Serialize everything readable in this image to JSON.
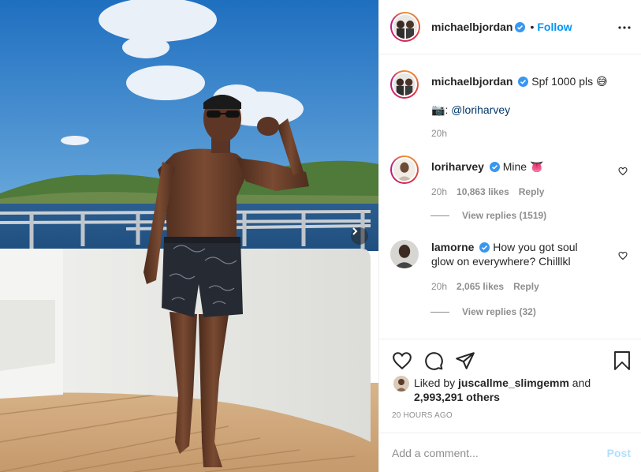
{
  "header": {
    "username": "michaelbjordan",
    "follow_label": "Follow",
    "separator": "•",
    "more_icon": "more-dots-icon"
  },
  "caption": {
    "username": "michaelbjordan",
    "text": "Spf 1000 pls 😅",
    "camera_emoji": "📷",
    "mention": "@loriharvey",
    "time": "20h"
  },
  "comments": [
    {
      "username": "loriharvey",
      "text": "Mine 👅",
      "time": "20h",
      "likes": "10,863 likes",
      "reply_label": "Reply",
      "view_replies": "View replies (1519)"
    },
    {
      "username": "lamorne",
      "text": "How you got soul glow on everywhere? Chilllkl",
      "time": "20h",
      "likes": "2,065 likes",
      "reply_label": "Reply",
      "view_replies": "View replies (32)"
    }
  ],
  "liked_by": {
    "prefix": "Liked by",
    "username": "juscallme_slimgemm",
    "connector": "and",
    "others": "2,993,291 others"
  },
  "timestamp": "20 HOURS AGO",
  "add_comment": {
    "placeholder": "Add a comment...",
    "post_label": "Post"
  },
  "colors": {
    "link_blue": "#0095f6",
    "verified_blue": "#3897f0",
    "muted_gray": "#8e8e8e",
    "post_disabled": "#b2dffc"
  }
}
